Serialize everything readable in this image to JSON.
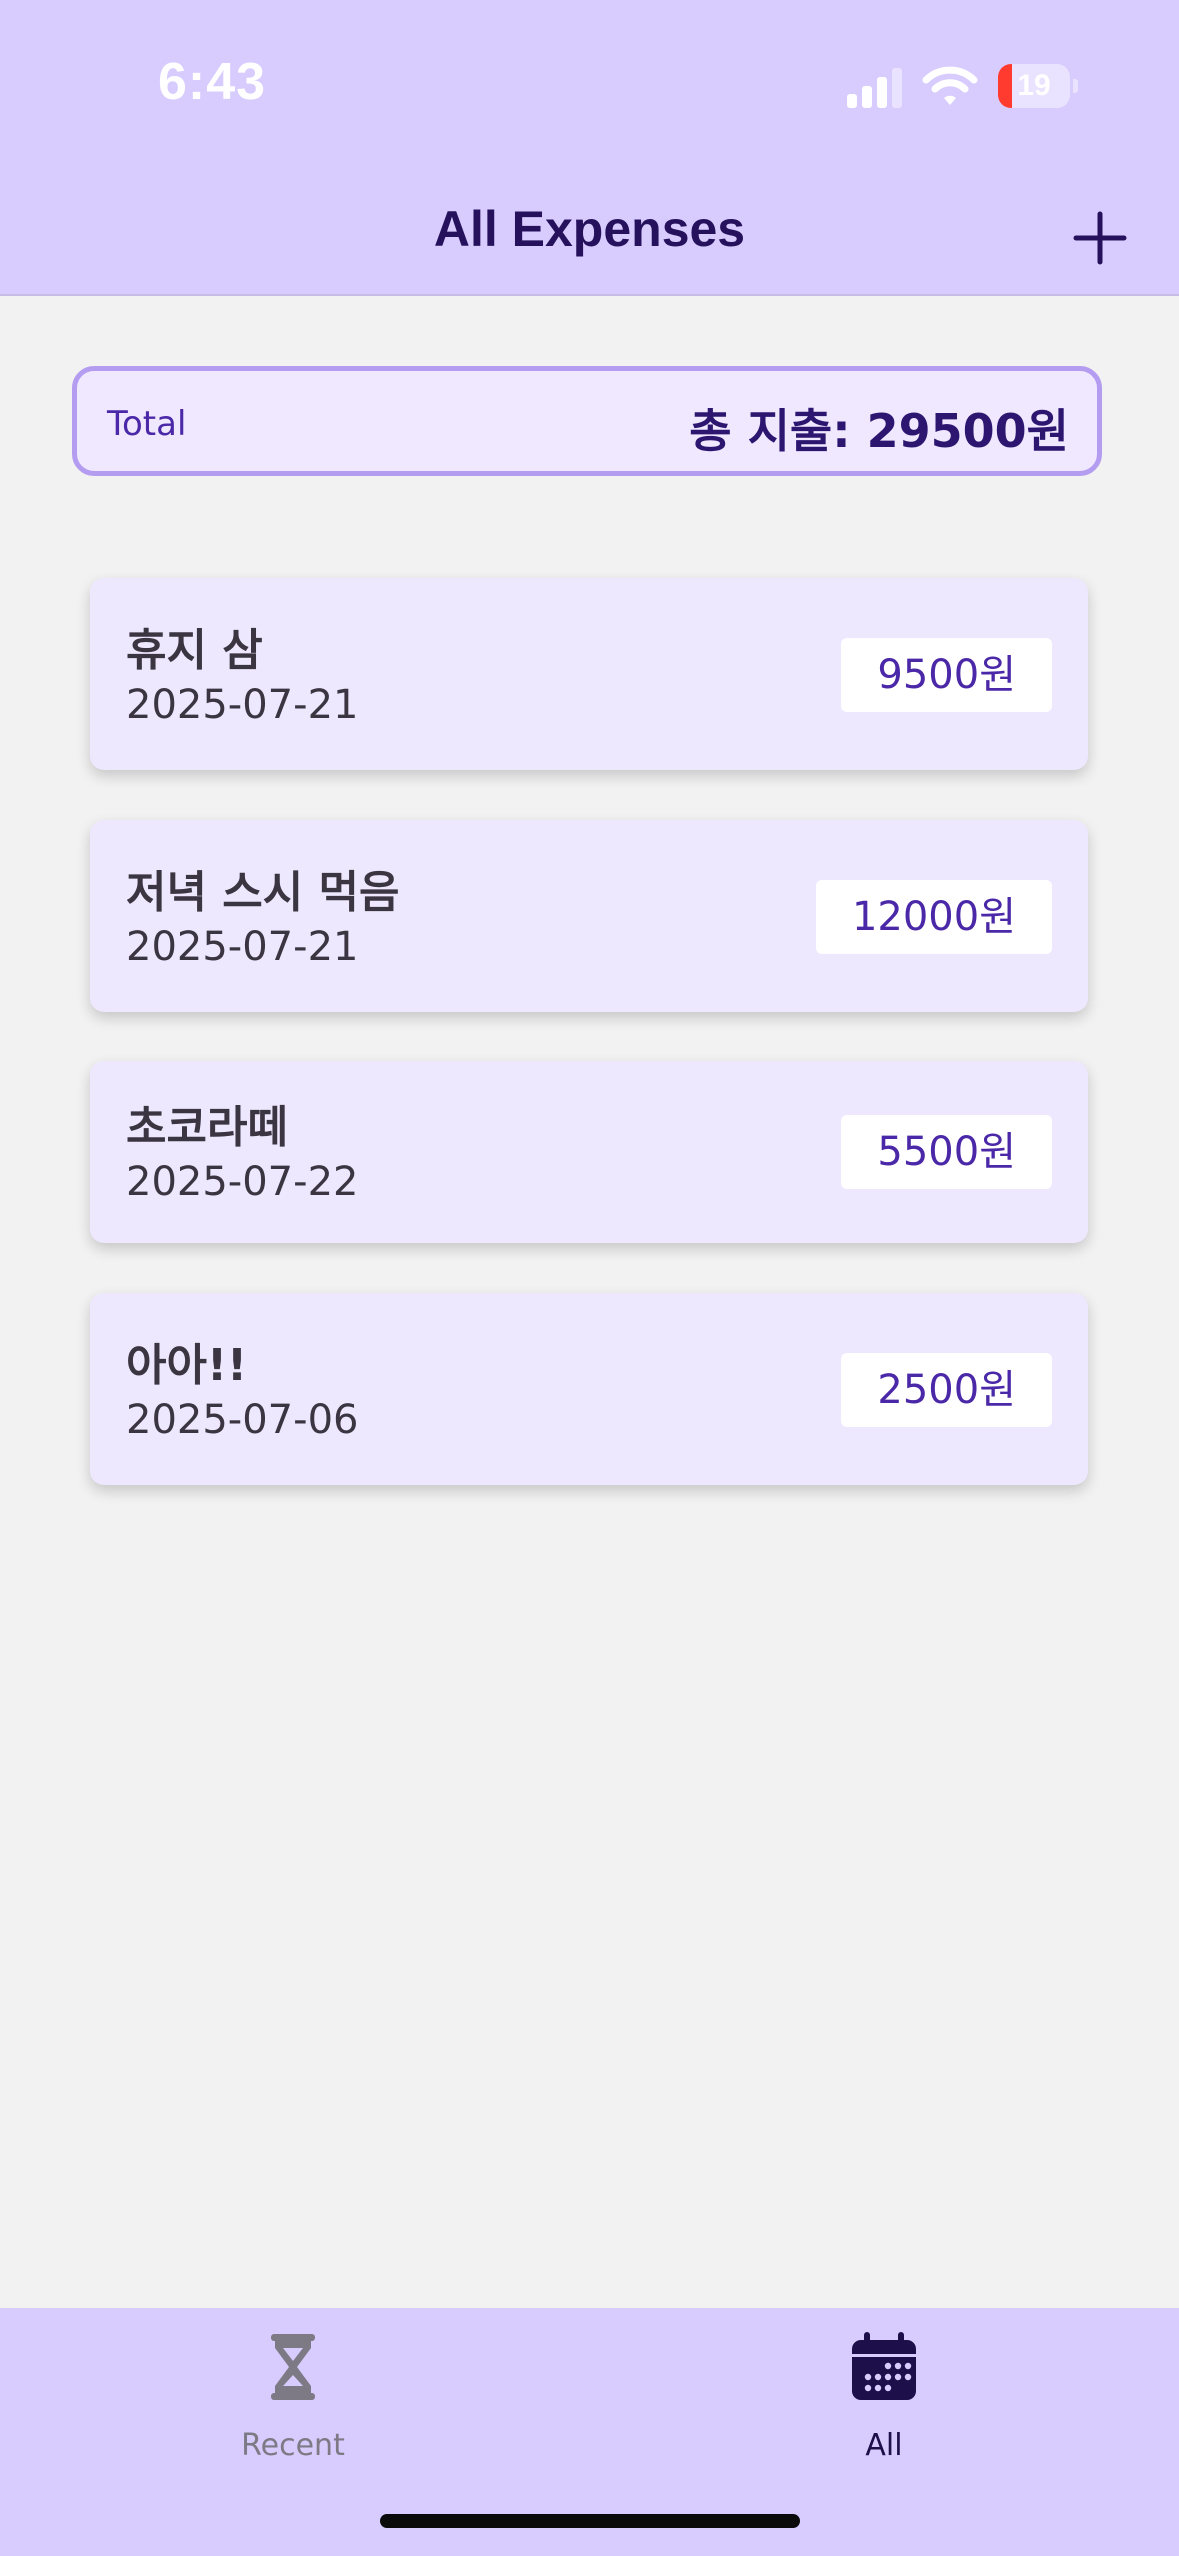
{
  "status_bar": {
    "time": "6:43",
    "battery_level": "19",
    "battery_fraction": 0.19,
    "signal_icon": "cellular-signal-icon",
    "wifi_icon": "wifi-icon"
  },
  "header": {
    "title": "All Expenses",
    "add_icon": "plus-icon"
  },
  "total": {
    "label": "Total",
    "value": "총 지출: 29500원"
  },
  "expenses": [
    {
      "title": "휴지 삼",
      "date": "2025-07-21",
      "amount": "9500원"
    },
    {
      "title": "저녁 스시 먹음",
      "date": "2025-07-21",
      "amount": "12000원"
    },
    {
      "title": "초코라떼",
      "date": "2025-07-22",
      "amount": "5500원"
    },
    {
      "title": "아아!!",
      "date": "2025-07-06",
      "amount": "2500원"
    }
  ],
  "tab_bar": {
    "tabs": [
      {
        "label": "Recent",
        "icon": "hourglass-icon",
        "selected": false
      },
      {
        "label": "All",
        "icon": "calendar-icon",
        "selected": true
      }
    ]
  },
  "colors": {
    "header_bg": "#d8ccff",
    "accent": "#4a28a8",
    "title": "#26125c",
    "card_bg": "#eee8ff",
    "total_border": "#b49cf0",
    "battery_low": "#ff3b30"
  }
}
